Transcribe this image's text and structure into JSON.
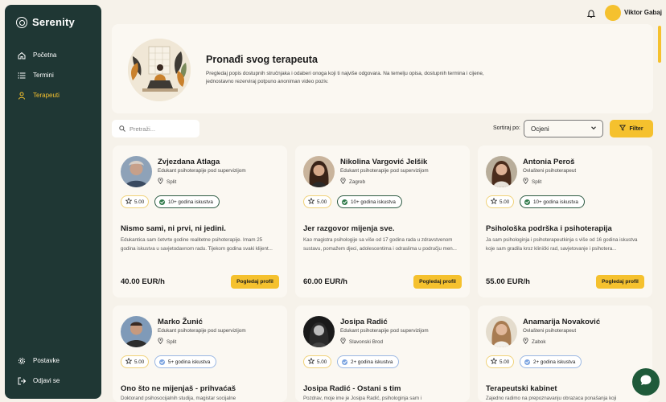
{
  "app": {
    "name": "Serenity"
  },
  "sidebar": {
    "items": [
      {
        "label": "Početna",
        "icon": "home-icon"
      },
      {
        "label": "Termini",
        "icon": "list-icon"
      },
      {
        "label": "Terapeuti",
        "icon": "user-icon",
        "active": true
      }
    ],
    "bottom_items": [
      {
        "label": "Postavke",
        "icon": "gear-icon"
      },
      {
        "label": "Odjavi se",
        "icon": "logout-icon"
      }
    ]
  },
  "header": {
    "user_name": "Viktor Gabaj"
  },
  "hero": {
    "title": "Pronađi svog terapeuta",
    "description": "Pregledaj popis dostupnih stručnjaka i odaberi onoga koji ti najviše odgovara. Na temelju opisa, dostupnih termina i cijene, jednostavno rezerviraj potpuno anoniman video poziv."
  },
  "toolbar": {
    "search_placeholder": "Pretraži...",
    "sort_label": "Sortiraj po:",
    "sort_value": "Ocjeni",
    "filter_label": "Filter"
  },
  "button_label": "Pogledaj profil",
  "therapists": [
    {
      "name": "Zvjezdana Atlaga",
      "role": "Edukant psihoterapije pod supervizijom",
      "location": "Split",
      "rating": "5.00",
      "experience": "10+ godina iskustva",
      "title": "Nismo sami, ni prvi, ni jedini.",
      "description": "Edukantica sam četvrte godine realitetne psihoterapije. Imam 25 godina iskustva u savjetodavnom radu. Tijekom godina svaki klijent...",
      "price": "40.00 EUR/h"
    },
    {
      "name": "Nikolina Vargović Jelšik",
      "role": "Edukant psihoterapije pod supervizijom",
      "location": "Zagreb",
      "rating": "5.00",
      "experience": "10+ godina iskustva",
      "title": "Jer razgovor mijenja sve.",
      "description": "Kao magistra psihologije sa više od 17 godina rada u zdravstvenom sustavu, pomažem djeci, adolescentima i odraslima u području men...",
      "price": "60.00 EUR/h"
    },
    {
      "name": "Antonia Peroš",
      "role": "Ovlašteni psihoterapeut",
      "location": "Split",
      "rating": "5.00",
      "experience": "10+ godina iskustva",
      "title": "Psihološka podrška i psihoterapija",
      "description": "Ja sam psihologinja i psihoterapeutkinja s više od 16 godina iskustva koje sam gradila kroz klinički rad, savjetovanje i psihotera...",
      "price": "55.00 EUR/h"
    },
    {
      "name": "Marko Žunić",
      "role": "Edukant psihoterapije pod supervizijom",
      "location": "Split",
      "rating": "5.00",
      "experience": "5+ godina iskustva",
      "title": "Ono što ne mijenjaš - prihvaćaš",
      "description": "Doktorand psihosocijalnih studija, magistar socijalne"
    },
    {
      "name": "Josipa Radić",
      "role": "Edukant psihoterapije pod supervizijom",
      "location": "Slavonski Brod",
      "rating": "5.00",
      "experience": "2+ godina iskustva",
      "title": "Josipa Radić - Ostani s tim",
      "description": "Pozdrav, moje ime je Josipa Radić, psihologinja sam i"
    },
    {
      "name": "Anamarija Novaković",
      "role": "Ovlašteni psihoterapeut",
      "location": "Zabok",
      "rating": "5.00",
      "experience": "2+ godina iskustva",
      "title": "Terapeutski kabinet",
      "description": "Zajedno radimo na prepoznavanju obrazaca ponašanja koji"
    }
  ]
}
